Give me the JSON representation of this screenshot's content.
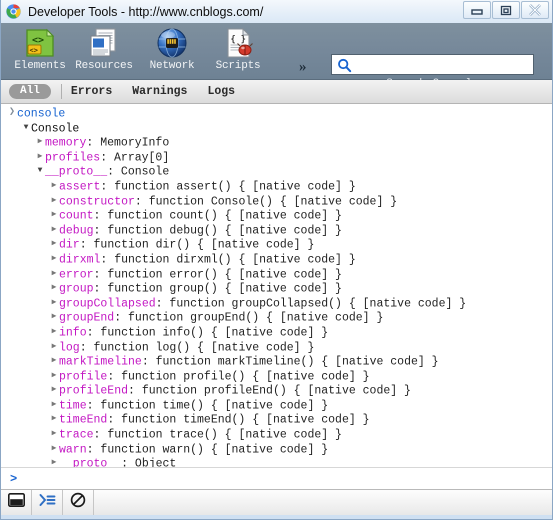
{
  "window": {
    "title": "Developer Tools - http://www.cnblogs.com/",
    "logo_icon": "chrome-logo-icon",
    "buttons": [
      {
        "name": "minimize-button",
        "icon": "minimize-icon"
      },
      {
        "name": "restore-button",
        "icon": "restore-icon"
      },
      {
        "name": "close-button",
        "icon": "close-icon"
      }
    ]
  },
  "toolbar": {
    "panels": [
      {
        "label": "Elements",
        "icon": "elements-icon"
      },
      {
        "label": "Resources",
        "icon": "resources-icon"
      },
      {
        "label": "Network",
        "icon": "network-icon"
      },
      {
        "label": "Scripts",
        "icon": "scripts-icon"
      }
    ],
    "more_label": "»",
    "more_icon": "chevron-double-right-icon",
    "search": {
      "value": "",
      "placeholder": "",
      "icon": "search-icon",
      "caption": "Search Console"
    }
  },
  "filterbar": {
    "all_label": "All",
    "items": [
      {
        "label": "Errors"
      },
      {
        "label": "Warnings"
      },
      {
        "label": "Logs"
      }
    ]
  },
  "console": {
    "rows": [
      {
        "indent": 0,
        "tri": "prompt",
        "text": "console",
        "style": "blue"
      },
      {
        "indent": 1,
        "tri": "open",
        "text": "Console",
        "style": "dark"
      },
      {
        "indent": 2,
        "tri": "closed",
        "prop": "memory",
        "val": " MemoryInfo"
      },
      {
        "indent": 2,
        "tri": "closed",
        "prop": "profiles",
        "val": " Array[0]"
      },
      {
        "indent": 2,
        "tri": "open",
        "prop": "__proto__",
        "val": " Console"
      },
      {
        "indent": 3,
        "tri": "closed",
        "prop": "assert",
        "val": " function assert() { [native code] }"
      },
      {
        "indent": 3,
        "tri": "closed",
        "prop": "constructor",
        "val": " function Console() { [native code] }"
      },
      {
        "indent": 3,
        "tri": "closed",
        "prop": "count",
        "val": " function count() { [native code] }"
      },
      {
        "indent": 3,
        "tri": "closed",
        "prop": "debug",
        "val": " function debug() { [native code] }"
      },
      {
        "indent": 3,
        "tri": "closed",
        "prop": "dir",
        "val": " function dir() { [native code] }"
      },
      {
        "indent": 3,
        "tri": "closed",
        "prop": "dirxml",
        "val": " function dirxml() { [native code] }"
      },
      {
        "indent": 3,
        "tri": "closed",
        "prop": "error",
        "val": " function error() { [native code] }"
      },
      {
        "indent": 3,
        "tri": "closed",
        "prop": "group",
        "val": " function group() { [native code] }"
      },
      {
        "indent": 3,
        "tri": "closed",
        "prop": "groupCollapsed",
        "val": " function groupCollapsed() { [native code] }"
      },
      {
        "indent": 3,
        "tri": "closed",
        "prop": "groupEnd",
        "val": " function groupEnd() { [native code] }"
      },
      {
        "indent": 3,
        "tri": "closed",
        "prop": "info",
        "val": " function info() { [native code] }"
      },
      {
        "indent": 3,
        "tri": "closed",
        "prop": "log",
        "val": " function log() { [native code] }"
      },
      {
        "indent": 3,
        "tri": "closed",
        "prop": "markTimeline",
        "val": " function markTimeline() { [native code] }"
      },
      {
        "indent": 3,
        "tri": "closed",
        "prop": "profile",
        "val": " function profile() { [native code] }"
      },
      {
        "indent": 3,
        "tri": "closed",
        "prop": "profileEnd",
        "val": " function profileEnd() { [native code] }"
      },
      {
        "indent": 3,
        "tri": "closed",
        "prop": "time",
        "val": " function time() { [native code] }"
      },
      {
        "indent": 3,
        "tri": "closed",
        "prop": "timeEnd",
        "val": " function timeEnd() { [native code] }"
      },
      {
        "indent": 3,
        "tri": "closed",
        "prop": "trace",
        "val": " function trace() { [native code] }"
      },
      {
        "indent": 3,
        "tri": "closed",
        "prop": "warn",
        "val": " function warn() { [native code] }"
      },
      {
        "indent": 3,
        "tri": "closed",
        "prop": "__proto__",
        "val": " Object"
      }
    ],
    "prompt": {
      "arrow": ">",
      "value": "",
      "placeholder": ""
    }
  },
  "statusbar": {
    "buttons": [
      {
        "name": "dock-to-window-button",
        "icon": "dock-window-icon"
      },
      {
        "name": "show-console-button",
        "icon": "console-prompt-icon"
      },
      {
        "name": "clear-console-button",
        "icon": "clear-no-entry-icon"
      }
    ]
  },
  "colors": {
    "toolbar_bg": "#76889a",
    "property_name": "#c317c3",
    "link_blue": "#1763d0",
    "pill_gray": "#9a9a9a"
  }
}
